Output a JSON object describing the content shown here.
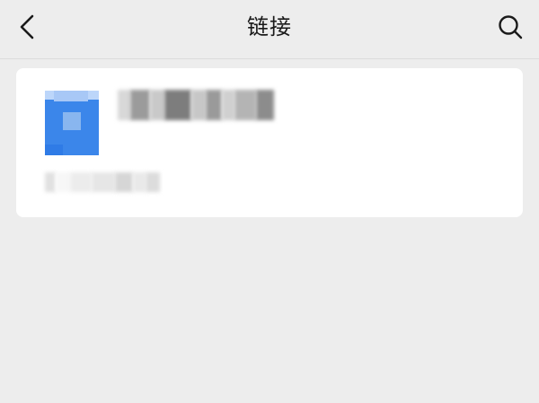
{
  "header": {
    "title": "链接",
    "back_icon": "chevron-left-icon",
    "search_icon": "search-icon"
  },
  "colors": {
    "background": "#ededed",
    "card": "#ffffff",
    "file_icon_blue": "#3b86ea",
    "file_icon_light": "#89b6ef"
  },
  "link_items": [
    {
      "icon": "file-icon",
      "title_redacted": true,
      "meta_redacted": true,
      "meta_visible_suffix": "9"
    }
  ]
}
